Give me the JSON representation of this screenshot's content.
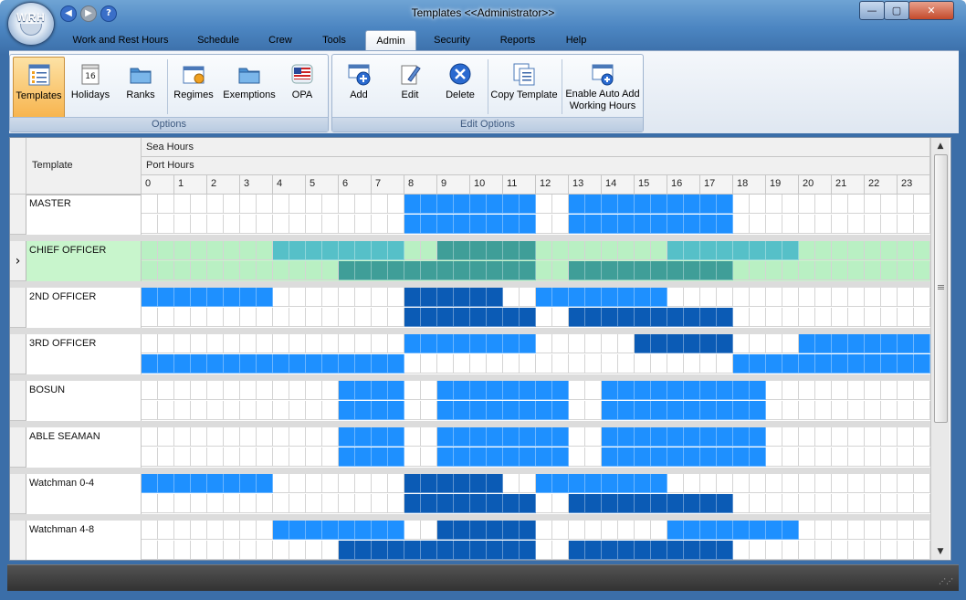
{
  "window": {
    "title": "Templates <<Administrator>>",
    "logo_text": "WRH",
    "controls": {
      "minimize": "—",
      "maximize": "▢",
      "close": "✕"
    }
  },
  "quick_access": {
    "back": "◀",
    "forward": "▶",
    "help": "?"
  },
  "tabs": [
    {
      "label": "Work and Rest Hours",
      "active": false
    },
    {
      "label": "Schedule",
      "active": false
    },
    {
      "label": "Crew",
      "active": false
    },
    {
      "label": "Tools",
      "active": false
    },
    {
      "label": "Admin",
      "active": true
    },
    {
      "label": "Security",
      "active": false
    },
    {
      "label": "Reports",
      "active": false
    },
    {
      "label": "Help",
      "active": false
    }
  ],
  "ribbon": {
    "options_group": {
      "label": "Options",
      "buttons": [
        {
          "label": "Templates",
          "icon": "templates-icon",
          "active": true
        },
        {
          "label": "Holidays",
          "icon": "calendar-icon",
          "active": false
        },
        {
          "label": "Ranks",
          "icon": "folder-icon",
          "active": false
        },
        {
          "label": "Regimes",
          "icon": "regimes-icon",
          "active": false
        },
        {
          "label": "Exemptions",
          "icon": "folder-icon",
          "active": false
        },
        {
          "label": "OPA",
          "icon": "flag-icon",
          "active": false
        }
      ]
    },
    "edit_group": {
      "label": "Edit Options",
      "buttons": [
        {
          "label": "Add",
          "icon": "add-icon"
        },
        {
          "label": "Edit",
          "icon": "edit-icon"
        },
        {
          "label": "Delete",
          "icon": "delete-icon"
        },
        {
          "label": "Copy Template",
          "icon": "copy-icon"
        },
        {
          "label": "Enable Auto Add",
          "label2": "Working Hours",
          "icon": "auto-add-icon"
        }
      ]
    }
  },
  "grid": {
    "header_template": "Template",
    "header_sea": "Sea Hours",
    "header_port": "Port Hours",
    "hours": [
      "0",
      "1",
      "2",
      "3",
      "4",
      "5",
      "6",
      "7",
      "8",
      "9",
      "10",
      "11",
      "12",
      "13",
      "14",
      "15",
      "16",
      "17",
      "18",
      "19",
      "20",
      "21",
      "22",
      "23"
    ],
    "selected_row_marker": "›",
    "colors": {
      "blue": "#1e90ff",
      "dark": "#0b5bb5",
      "sel_light": "#b9f0c3",
      "sel_med": "#56c0c8",
      "sel_dark": "#3f9e98",
      "selected_row_bg": "#c8f5cc",
      "white": "#ffffff"
    },
    "rows": [
      {
        "name": "MASTER",
        "selected": false,
        "sea": "0000000000000000BBBBBBBB00BBBBBBBBBB000000000000",
        "port": "0000000000000000BBBBBBBB00BBBBBBBBBB000000000000"
      },
      {
        "name": "CHIEF OFFICER",
        "selected": true,
        "sea": "00000000MMMMMMMM00DDDDDD00000000MMMMMMMM00000000",
        "port": "000000000000DDDDDDDDDDDD00DDDDDDDDDD000000000000"
      },
      {
        "name": "2ND OFFICER",
        "selected": false,
        "sea": "BBBBBBBB00000000DDDDDD00BBBBBBBB0000000000000000",
        "port": "0000000000000000DDDDDDDD00DDDDDDDDDD000000000000"
      },
      {
        "name": "3RD OFFICER",
        "selected": false,
        "sea": "0000000000000000BBBBBBBB000000DDDDDD0000BBBBBBBB",
        "port": "BBBBBBBBBBBBBBBB00000000000000000000BBBBBBBBBBBB"
      },
      {
        "name": "BOSUN",
        "selected": false,
        "sea": "000000000000BBBB00BBBBBBBB00BBBBBBBBBB0000000000",
        "port": "000000000000BBBB00BBBBBBBB00BBBBBBBBBB0000000000"
      },
      {
        "name": "ABLE SEAMAN",
        "selected": false,
        "sea": "000000000000BBBB00BBBBBBBB00BBBBBBBBBB0000000000",
        "port": "000000000000BBBB00BBBBBBBB00BBBBBBBBBB0000000000"
      },
      {
        "name": "Watchman 0-4",
        "selected": false,
        "sea": "BBBBBBBB00000000DDDDDD00BBBBBBBB0000000000000000",
        "port": "0000000000000000DDDDDDDD00DDDDDDDDDD000000000000"
      },
      {
        "name": "Watchman 4-8",
        "selected": false,
        "sea": "00000000BBBBBBBB00DDDDDD00000000BBBBBBBB00000000",
        "port": "000000000000DDDDDDDDDDDD00DDDDDDDDDD000000000000"
      }
    ]
  }
}
